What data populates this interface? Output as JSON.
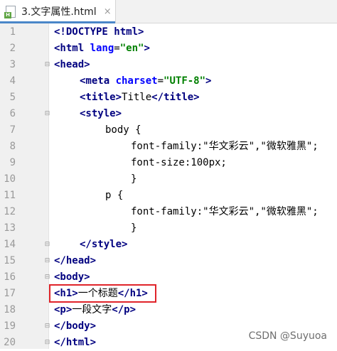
{
  "tab": {
    "file_name": "3.文字属性.html",
    "badge": "H",
    "close": "×"
  },
  "lines": [
    {
      "num": "1",
      "indent": 0,
      "tokens": [
        [
          "<!DOCTYPE ",
          "tag"
        ],
        [
          "html",
          "tag"
        ],
        [
          ">",
          "tag"
        ]
      ]
    },
    {
      "num": "2",
      "indent": 0,
      "tokens": [
        [
          "<html ",
          "tag"
        ],
        [
          "lang",
          "attr"
        ],
        [
          "=",
          "bracket"
        ],
        [
          "\"en\"",
          "val"
        ],
        [
          ">",
          "tag"
        ]
      ]
    },
    {
      "num": "3",
      "indent": 0,
      "tokens": [
        [
          "<head>",
          "tag"
        ]
      ]
    },
    {
      "num": "4",
      "indent": 1,
      "tokens": [
        [
          "<meta ",
          "tag"
        ],
        [
          "charset",
          "attr"
        ],
        [
          "=",
          "bracket"
        ],
        [
          "\"UTF-8\"",
          "val"
        ],
        [
          ">",
          "tag"
        ]
      ]
    },
    {
      "num": "5",
      "indent": 1,
      "tokens": [
        [
          "<title>",
          "tag"
        ],
        [
          "Title",
          "prop"
        ],
        [
          "</title>",
          "tag"
        ]
      ]
    },
    {
      "num": "6",
      "indent": 1,
      "tokens": [
        [
          "<style>",
          "tag"
        ]
      ]
    },
    {
      "num": "7",
      "indent": 2,
      "tokens": [
        [
          "body {",
          "prop"
        ]
      ]
    },
    {
      "num": "8",
      "indent": 3,
      "tokens": [
        [
          "font-family:\"华文彩云\",\"微软雅黑\";",
          "prop"
        ]
      ]
    },
    {
      "num": "9",
      "indent": 3,
      "tokens": [
        [
          "font-size:100px;",
          "prop"
        ]
      ]
    },
    {
      "num": "10",
      "indent": 3,
      "tokens": [
        [
          "}",
          "prop"
        ]
      ]
    },
    {
      "num": "11",
      "indent": 2,
      "tokens": [
        [
          "p {",
          "prop"
        ]
      ]
    },
    {
      "num": "12",
      "indent": 3,
      "tokens": [
        [
          "font-family:\"华文彩云\",\"微软雅黑\";",
          "prop"
        ]
      ]
    },
    {
      "num": "13",
      "indent": 3,
      "tokens": [
        [
          "}",
          "prop"
        ]
      ]
    },
    {
      "num": "14",
      "indent": 1,
      "tokens": [
        [
          "</style>",
          "tag"
        ]
      ]
    },
    {
      "num": "15",
      "indent": 0,
      "tokens": [
        [
          "</head>",
          "tag"
        ]
      ]
    },
    {
      "num": "16",
      "indent": 0,
      "tokens": [
        [
          "<body>",
          "tag"
        ]
      ]
    },
    {
      "num": "17",
      "indent": 0,
      "tokens": [
        [
          "<h1>",
          "tag"
        ],
        [
          "一个标题",
          "prop"
        ],
        [
          "</h1>",
          "tag"
        ]
      ]
    },
    {
      "num": "18",
      "indent": 0,
      "tokens": [
        [
          "<p>",
          "tag"
        ],
        [
          "一段文字",
          "prop"
        ],
        [
          "</p>",
          "tag"
        ]
      ]
    },
    {
      "num": "19",
      "indent": 0,
      "tokens": [
        [
          "</body>",
          "tag"
        ]
      ]
    },
    {
      "num": "20",
      "indent": 0,
      "tokens": [
        [
          "</html>",
          "tag"
        ]
      ]
    }
  ],
  "fold_lines": [
    "3",
    "6",
    "14",
    "15",
    "16",
    "19",
    "20"
  ],
  "highlighted_line": "17",
  "watermark": "CSDN @Suyuoa",
  "colors": {
    "tag": "#000080",
    "attr": "#0000ff",
    "value": "#008000",
    "highlight": "#e0242a"
  }
}
